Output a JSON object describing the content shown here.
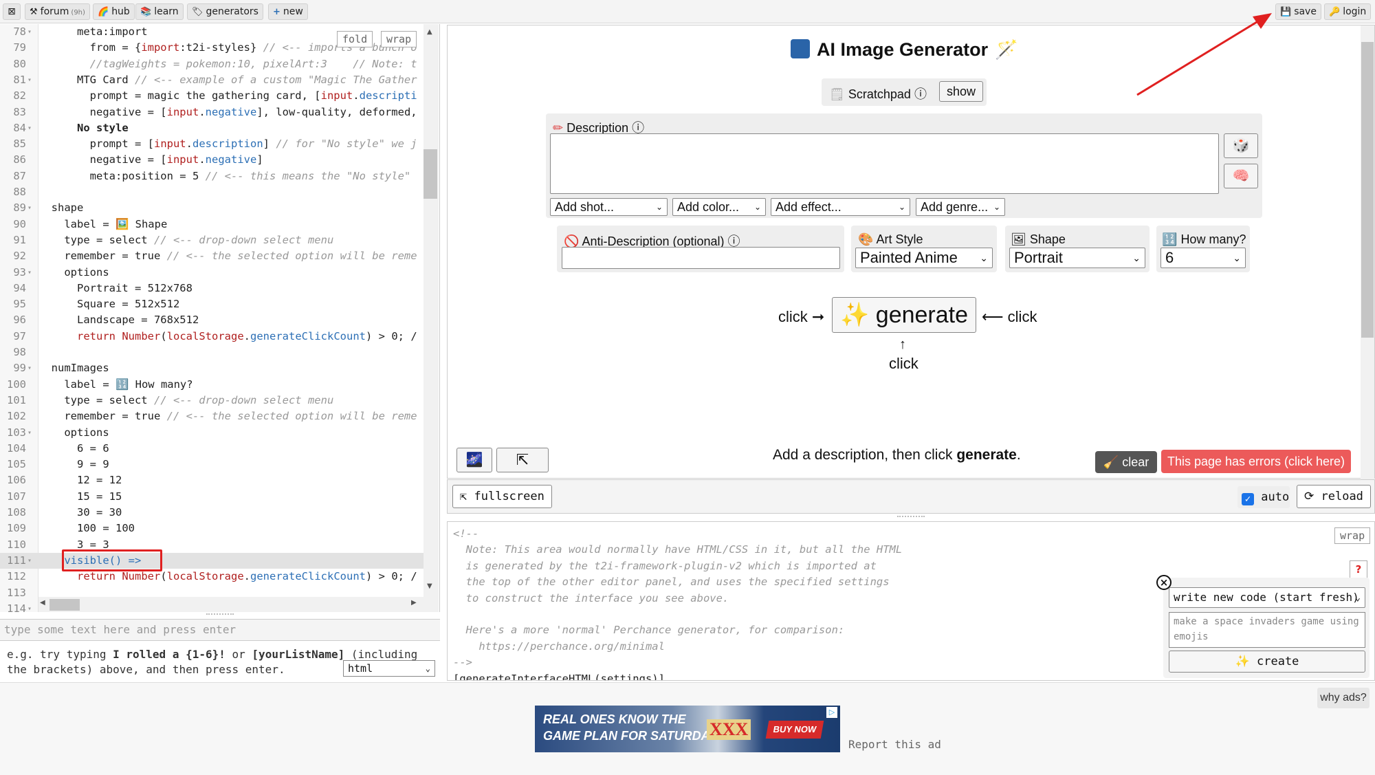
{
  "topbar": {
    "items": [
      {
        "icon": "⚒",
        "label": "forum",
        "badge": "(9h)"
      },
      {
        "icon": "🌈",
        "label": "hub"
      },
      {
        "icon": "📚",
        "label": "learn"
      },
      {
        "icon": "🏷",
        "label": "generators"
      },
      {
        "icon": "+",
        "label": "new"
      }
    ],
    "save_label": "save",
    "login_label": "login"
  },
  "editor": {
    "fold_label": "fold",
    "wrap_label": "wrap",
    "lines": [
      {
        "n": "78",
        "fold": "▾",
        "t": "      meta:import"
      },
      {
        "n": "79",
        "fold": "",
        "t": "        from = {import:t2i-styles} // <-- imports a bunch o"
      },
      {
        "n": "80",
        "fold": "",
        "t": "        //tagWeights = pokemon:10, pixelArt:3    // Note: t"
      },
      {
        "n": "81",
        "fold": "▾",
        "t": "      MTG Card // <-- example of a custom \"Magic The Gather"
      },
      {
        "n": "82",
        "fold": "",
        "t": "        prompt = magic the gathering card, [input.descripti"
      },
      {
        "n": "83",
        "fold": "",
        "t": "        negative = [input.negative], low-quality, deformed,"
      },
      {
        "n": "84",
        "fold": "▾",
        "t": "      No style"
      },
      {
        "n": "85",
        "fold": "",
        "t": "        prompt = [input.description] // for \"No style\" we j"
      },
      {
        "n": "86",
        "fold": "",
        "t": "        negative = [input.negative]"
      },
      {
        "n": "87",
        "fold": "",
        "t": "        meta:position = 5 // <-- this means the \"No style\""
      },
      {
        "n": "88",
        "fold": "",
        "t": ""
      },
      {
        "n": "89",
        "fold": "▾",
        "t": "  shape"
      },
      {
        "n": "90",
        "fold": "",
        "t": "    label = 🖼️ Shape"
      },
      {
        "n": "91",
        "fold": "",
        "t": "    type = select // <-- drop-down select menu"
      },
      {
        "n": "92",
        "fold": "",
        "t": "    remember = true // <-- the selected option will be reme"
      },
      {
        "n": "93",
        "fold": "▾",
        "t": "    options"
      },
      {
        "n": "94",
        "fold": "",
        "t": "      Portrait = 512x768"
      },
      {
        "n": "95",
        "fold": "",
        "t": "      Square = 512x512"
      },
      {
        "n": "96",
        "fold": "",
        "t": "      Landscape = 768x512"
      },
      {
        "n": "97",
        "fold": "",
        "t": "      return Number(localStorage.generateClickCount) > 0; /"
      },
      {
        "n": "98",
        "fold": "",
        "t": ""
      },
      {
        "n": "99",
        "fold": "▾",
        "t": "  numImages"
      },
      {
        "n": "100",
        "fold": "",
        "t": "    label = 🔢 How many?"
      },
      {
        "n": "101",
        "fold": "",
        "t": "    type = select // <-- drop-down select menu"
      },
      {
        "n": "102",
        "fold": "",
        "t": "    remember = true // <-- the selected option will be reme"
      },
      {
        "n": "103",
        "fold": "▾",
        "t": "    options"
      },
      {
        "n": "104",
        "fold": "",
        "t": "      6 = 6"
      },
      {
        "n": "105",
        "fold": "",
        "t": "      9 = 9"
      },
      {
        "n": "106",
        "fold": "",
        "t": "      12 = 12"
      },
      {
        "n": "107",
        "fold": "",
        "t": "      15 = 15"
      },
      {
        "n": "108",
        "fold": "",
        "t": "      30 = 30"
      },
      {
        "n": "109",
        "fold": "",
        "t": "      100 = 100"
      },
      {
        "n": "110",
        "fold": "",
        "t": "      3 = 3"
      },
      {
        "n": "111",
        "fold": "▾",
        "t": "    visible() =>"
      },
      {
        "n": "112",
        "fold": "",
        "t": "      return Number(localStorage.generateClickCount) > 0; /"
      },
      {
        "n": "113",
        "fold": "",
        "t": ""
      },
      {
        "n": "114",
        "fold": "▾",
        "t": ""
      }
    ]
  },
  "console": {
    "placeholder": "type some text here and press enter",
    "help_line1_prefix": "e.g. try typing ",
    "help_bold1": "I rolled a {1-6}!",
    "help_or": " or ",
    "help_bold2": "[yourListName]",
    "help_line1_suffix": " (including",
    "help_line2": "the brackets) above, and then press enter.",
    "lang": "html"
  },
  "generator": {
    "title": "AI Image Generator",
    "scratchpad_label": "Scratchpad",
    "show_label": "show",
    "description_label": "Description",
    "add_shot": "Add shot...",
    "add_color": "Add color...",
    "add_effect": "Add effect...",
    "add_genre": "Add genre...",
    "anti_label": "Anti-Description (optional)",
    "art_style_label": "Art Style",
    "art_style_value": "Painted Anime",
    "shape_label": "Shape",
    "shape_value": "Portrait",
    "how_many_label": "How many?",
    "how_many_value": "6",
    "click_left": "click",
    "click_right": "click",
    "click_bottom": "click",
    "generate_label": "generate",
    "status_prefix": "Add a description, then click ",
    "status_bold": "generate",
    "status_suffix": ".",
    "clear_label": "clear",
    "errors_label": "This page has errors (click here)"
  },
  "preview_bar": {
    "fullscreen_label": "fullscreen",
    "auto_label": "auto",
    "reload_label": "reload"
  },
  "html_editor": {
    "wrap_label": "wrap",
    "lines": [
      "<!--",
      "  Note: This area would normally have HTML/CSS in it, but all the HTML",
      "  is generated by the t2i-framework-plugin-v2 which is imported at",
      "  the top of the other editor panel, and uses the specified settings",
      "  to construct the interface you see above.",
      "",
      "  Here's a more 'normal' Perchance generator, for comparison:",
      "    https://perchance.org/minimal",
      "-->",
      "[generateInterfaceHTML(settings)]"
    ]
  },
  "ai_panel": {
    "mode_value": "write new code (start fresh)",
    "prompt_placeholder": "make a space invaders game using emojis",
    "create_label": "create",
    "help_label": "?"
  },
  "ads": {
    "why_ads": "why ads?",
    "report": "Report this ad",
    "ad_line1": "REAL ONES KNOW THE",
    "ad_line2": "GAME PLAN FOR SATURDAY",
    "ad_brand": "XXX",
    "ad_cta": "BUY NOW"
  },
  "colors": {
    "error_red": "#ec5a5a",
    "annotation_red": "#e02020",
    "code_keyword": "#b0201f",
    "code_blue": "#2c6fb5"
  }
}
